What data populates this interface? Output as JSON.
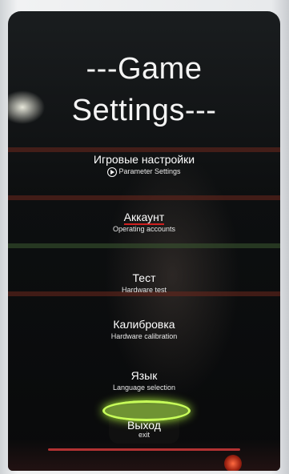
{
  "title": {
    "line1": "---Game",
    "line2": "Settings---"
  },
  "menu": [
    {
      "ru": "Игровые настройки",
      "en": "Parameter Settings"
    },
    {
      "ru": "Аккаунт",
      "en": "Operating accounts"
    },
    {
      "ru": "Тест",
      "en": "Hardware test"
    },
    {
      "ru": "Калибровка",
      "en": "Hardware calibration"
    },
    {
      "ru": "Язык",
      "en": "Language selection"
    },
    {
      "ru": "Выход",
      "en": "exit"
    }
  ],
  "colors": {
    "glow": "#c8ff5a",
    "accent": "#d02020"
  }
}
